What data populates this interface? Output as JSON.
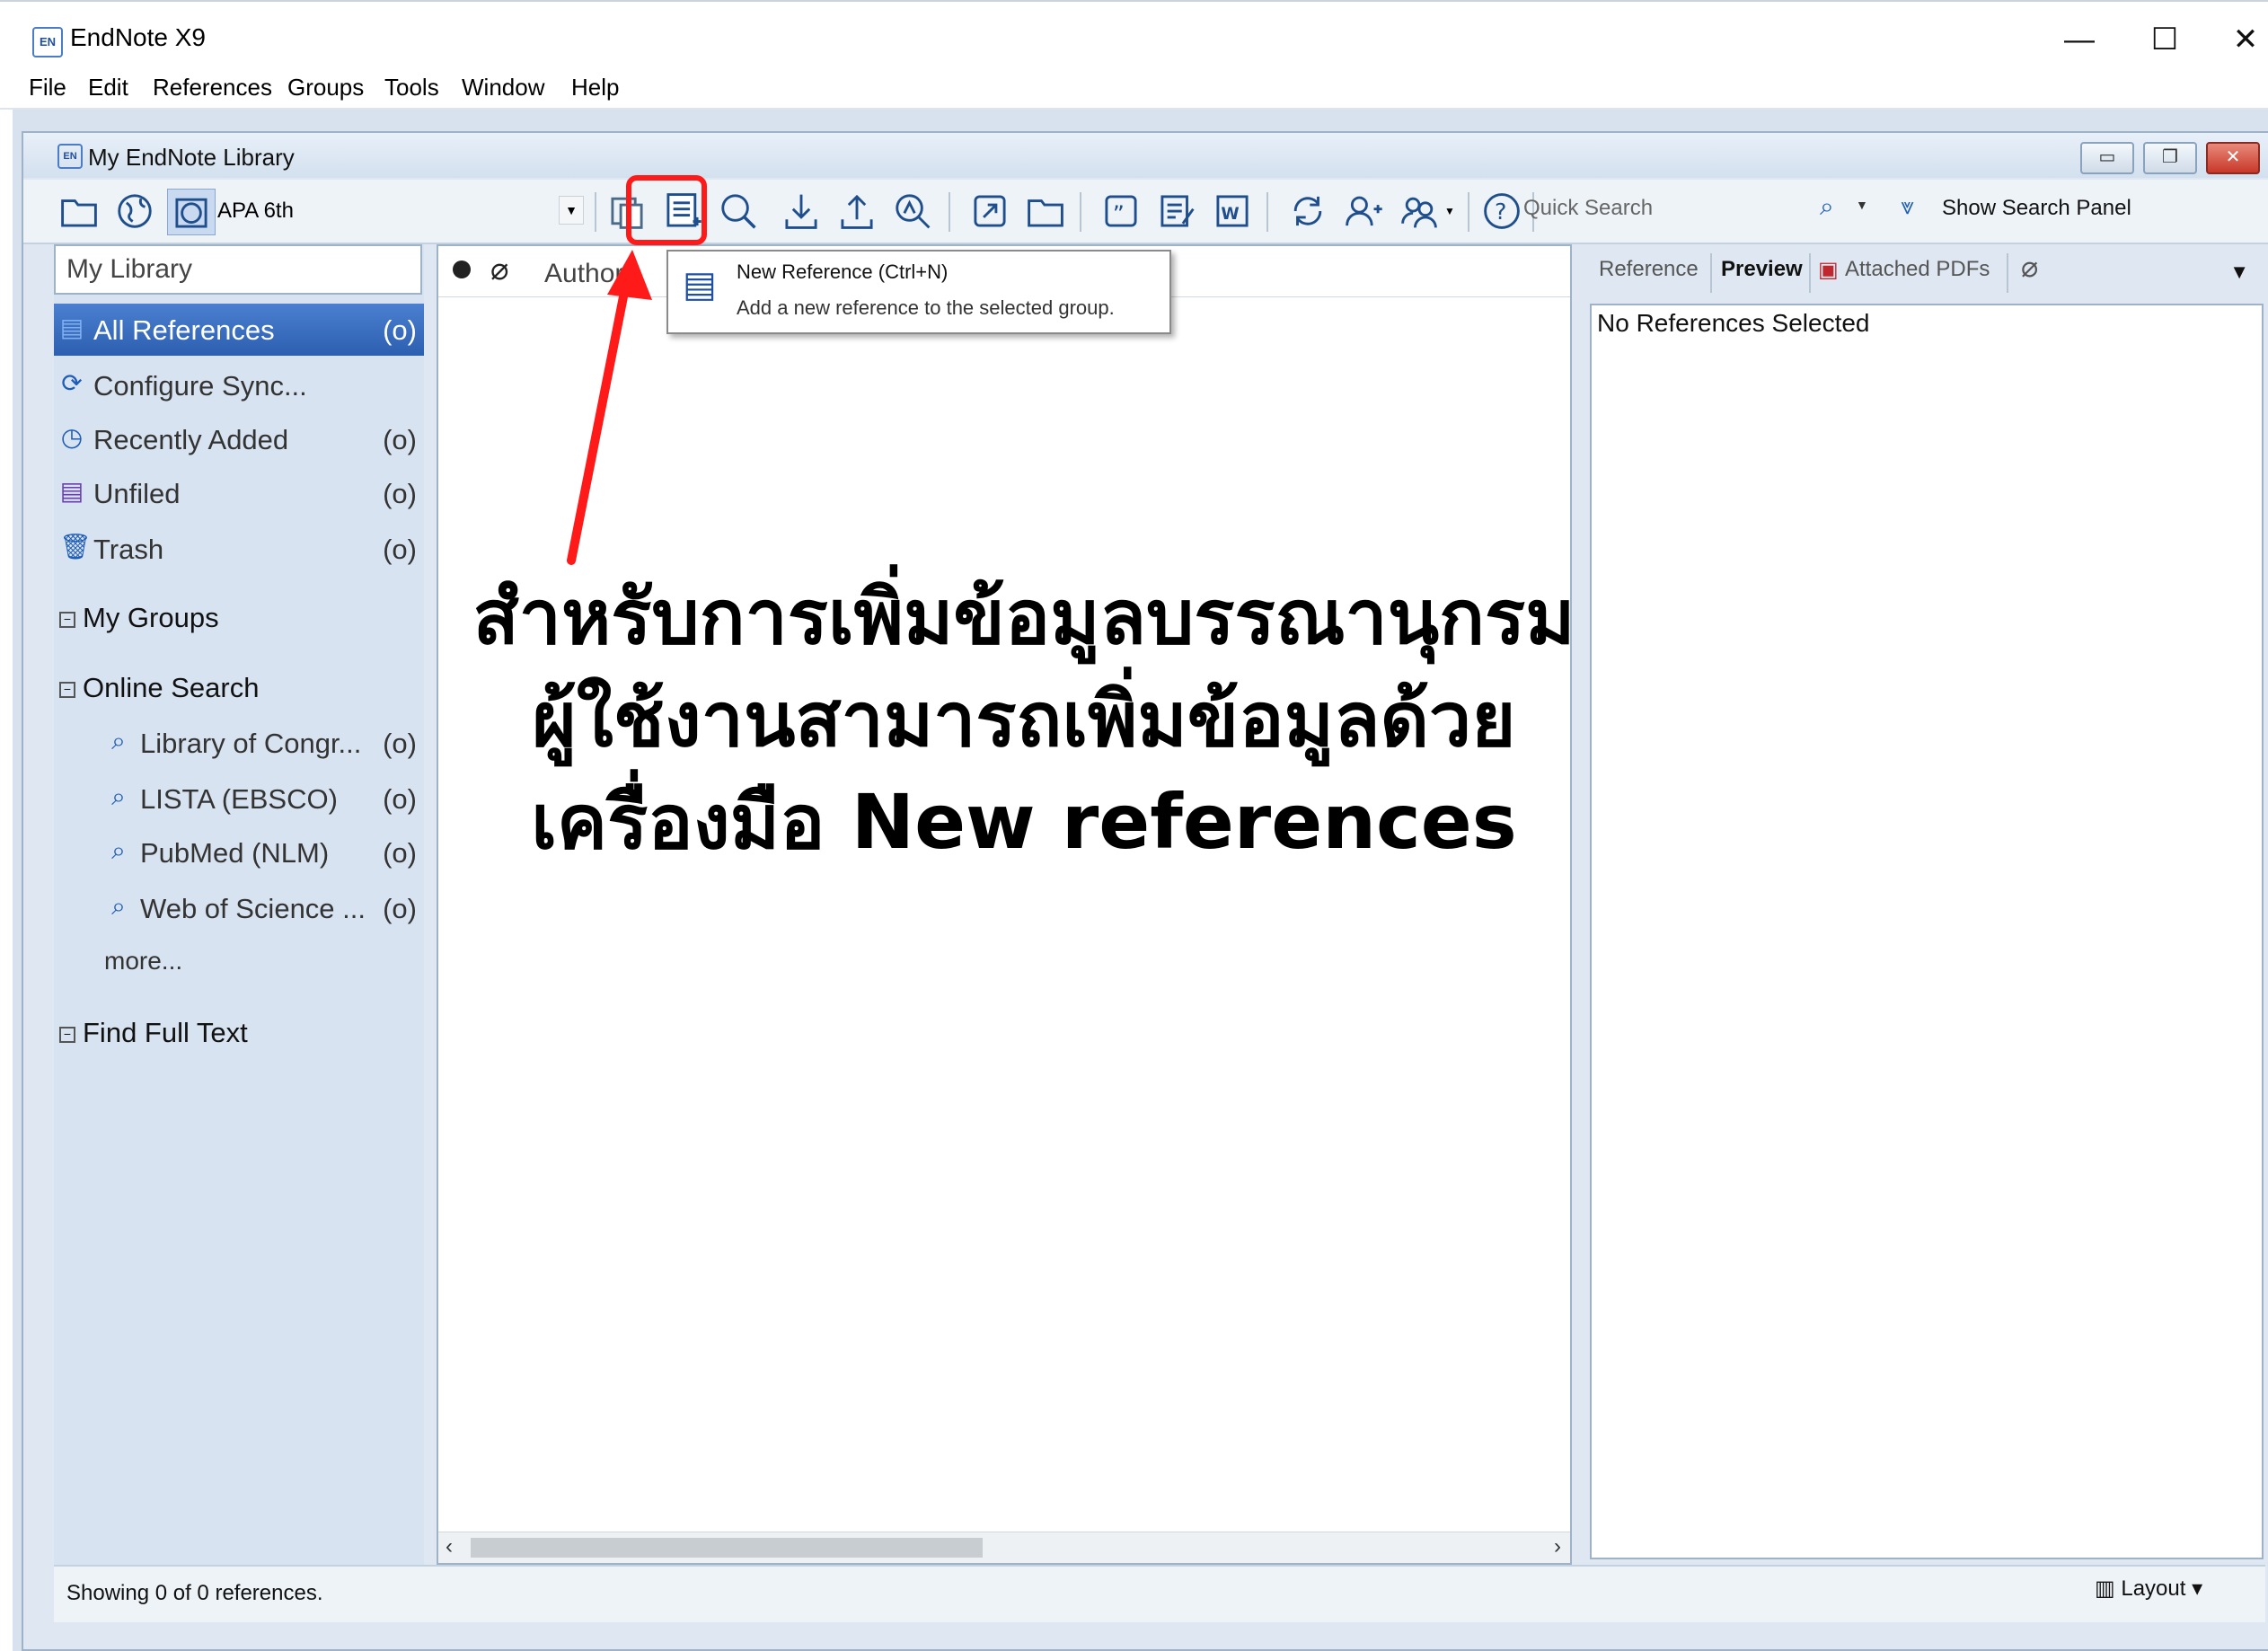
{
  "app": {
    "logo": "EN",
    "title": "EndNote X9",
    "window_controls": {
      "minimize": "—",
      "maximize": "☐",
      "close": "✕"
    }
  },
  "menu": [
    "File",
    "Edit",
    "References",
    "Groups",
    "Tools",
    "Window",
    "Help"
  ],
  "library_window": {
    "logo": "EN",
    "title": "My EndNote Library",
    "mdi_controls": {
      "minimize": "▭",
      "restore": "❐",
      "close": "✕"
    }
  },
  "toolbar": {
    "style": "APA 6th",
    "quick_search_placeholder": "Quick Search",
    "show_search_panel": "Show Search Panel"
  },
  "groups_panel": {
    "library_title": "My Library",
    "items": [
      {
        "label": "All References",
        "count": "(o)",
        "icon": "all-references-icon",
        "selected": true
      },
      {
        "label": "Configure Sync...",
        "count": "",
        "icon": "sync-icon",
        "selected": false
      },
      {
        "label": "Recently Added",
        "count": "(o)",
        "icon": "clock-icon",
        "selected": false
      },
      {
        "label": "Unfiled",
        "count": "(o)",
        "icon": "unfiled-icon",
        "selected": false
      },
      {
        "label": "Trash",
        "count": "(o)",
        "icon": "trash-icon",
        "selected": false
      }
    ],
    "my_groups": "My Groups",
    "online_search": "Online Search",
    "online_items": [
      {
        "label": "Library of Congr...",
        "count": "(o)"
      },
      {
        "label": "LISTA (EBSCO)",
        "count": "(o)"
      },
      {
        "label": "PubMed (NLM)",
        "count": "(o)"
      },
      {
        "label": "Web of Science ...",
        "count": "(o)"
      }
    ],
    "more": "more...",
    "find_full_text": "Find Full Text"
  },
  "reference_list": {
    "author_header": "Author"
  },
  "tooltip": {
    "title": "New Reference (Ctrl+N)",
    "description": "Add a new reference to the selected group."
  },
  "preview_panel": {
    "tabs": [
      "Reference",
      "Preview",
      "Attached PDFs"
    ],
    "active_tab": "Preview",
    "message": "No References Selected"
  },
  "status": {
    "text": "Showing 0 of 0 references.",
    "layout": "Layout"
  },
  "annotation": {
    "line1": "สำหรับการเพิ่มข้อมูลบรรณานุกรม",
    "line2": "ผู้ใช้งานสามารถเพิ่มข้อมูลด้วย",
    "line3": "เครื่องมือ New references",
    "highlight_color": "#ff1a1a"
  }
}
